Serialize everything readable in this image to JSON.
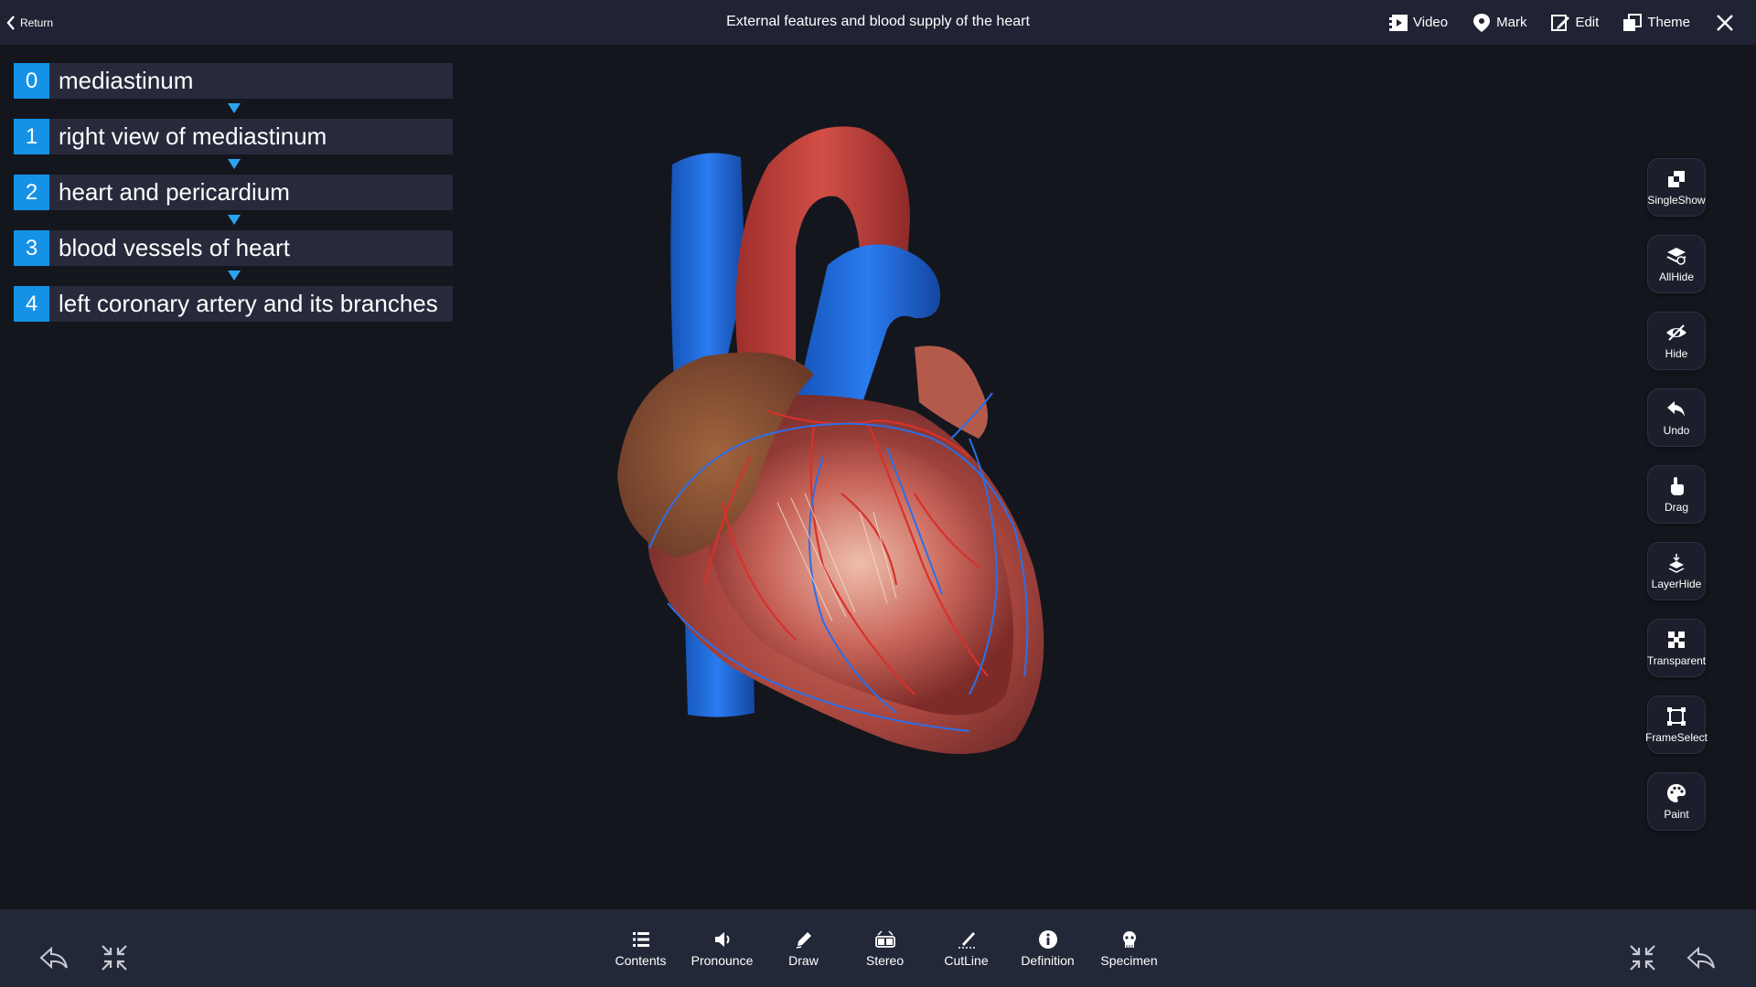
{
  "topbar": {
    "return_label": "Return",
    "title": "External features and blood supply of the heart",
    "actions": [
      {
        "label": "Video",
        "icon": "video-icon"
      },
      {
        "label": "Mark",
        "icon": "location-pin-icon"
      },
      {
        "label": "Edit",
        "icon": "edit-icon"
      },
      {
        "label": "Theme",
        "icon": "theme-icon"
      }
    ],
    "close_icon": "close-icon"
  },
  "breadcrumbs": [
    {
      "num": "0",
      "label": "mediastinum"
    },
    {
      "num": "1",
      "label": "right view of mediastinum"
    },
    {
      "num": "2",
      "label": "heart and pericardium"
    },
    {
      "num": "3",
      "label": "blood vessels of heart"
    },
    {
      "num": "4",
      "label": "left coronary artery and its branches"
    }
  ],
  "model": {
    "description_icon": "heart-model",
    "colors": {
      "artery": "#c9453f",
      "vein": "#1f6fe0",
      "myocardium": "#a8463f",
      "auricle": "#8a4a35"
    }
  },
  "right_tools": [
    {
      "label": "SingleShow",
      "icon": "single-show-icon"
    },
    {
      "label": "AllHide",
      "icon": "all-hide-icon"
    },
    {
      "label": "Hide",
      "icon": "hide-eye-icon"
    },
    {
      "label": "Undo",
      "icon": "undo-icon"
    },
    {
      "label": "Drag",
      "icon": "drag-hand-icon"
    },
    {
      "label": "LayerHide",
      "icon": "layer-hide-icon"
    },
    {
      "label": "Transparent",
      "icon": "transparent-icon"
    },
    {
      "label": "FrameSelect",
      "icon": "frame-select-icon"
    },
    {
      "label": "Paint",
      "icon": "paint-palette-icon"
    }
  ],
  "bottom_tools": [
    {
      "label": "Contents",
      "icon": "list-icon"
    },
    {
      "label": "Pronounce",
      "icon": "speaker-icon"
    },
    {
      "label": "Draw",
      "icon": "pen-icon"
    },
    {
      "label": "Stereo",
      "icon": "stereo-glasses-icon"
    },
    {
      "label": "CutLine",
      "icon": "cut-line-icon"
    },
    {
      "label": "Definition",
      "icon": "info-icon"
    },
    {
      "label": "Specimen",
      "icon": "specimen-icon"
    }
  ],
  "colors": {
    "accent": "#1591e6",
    "topbar": "#1f2333",
    "background": "#14161d",
    "bottombar": "#232838"
  }
}
